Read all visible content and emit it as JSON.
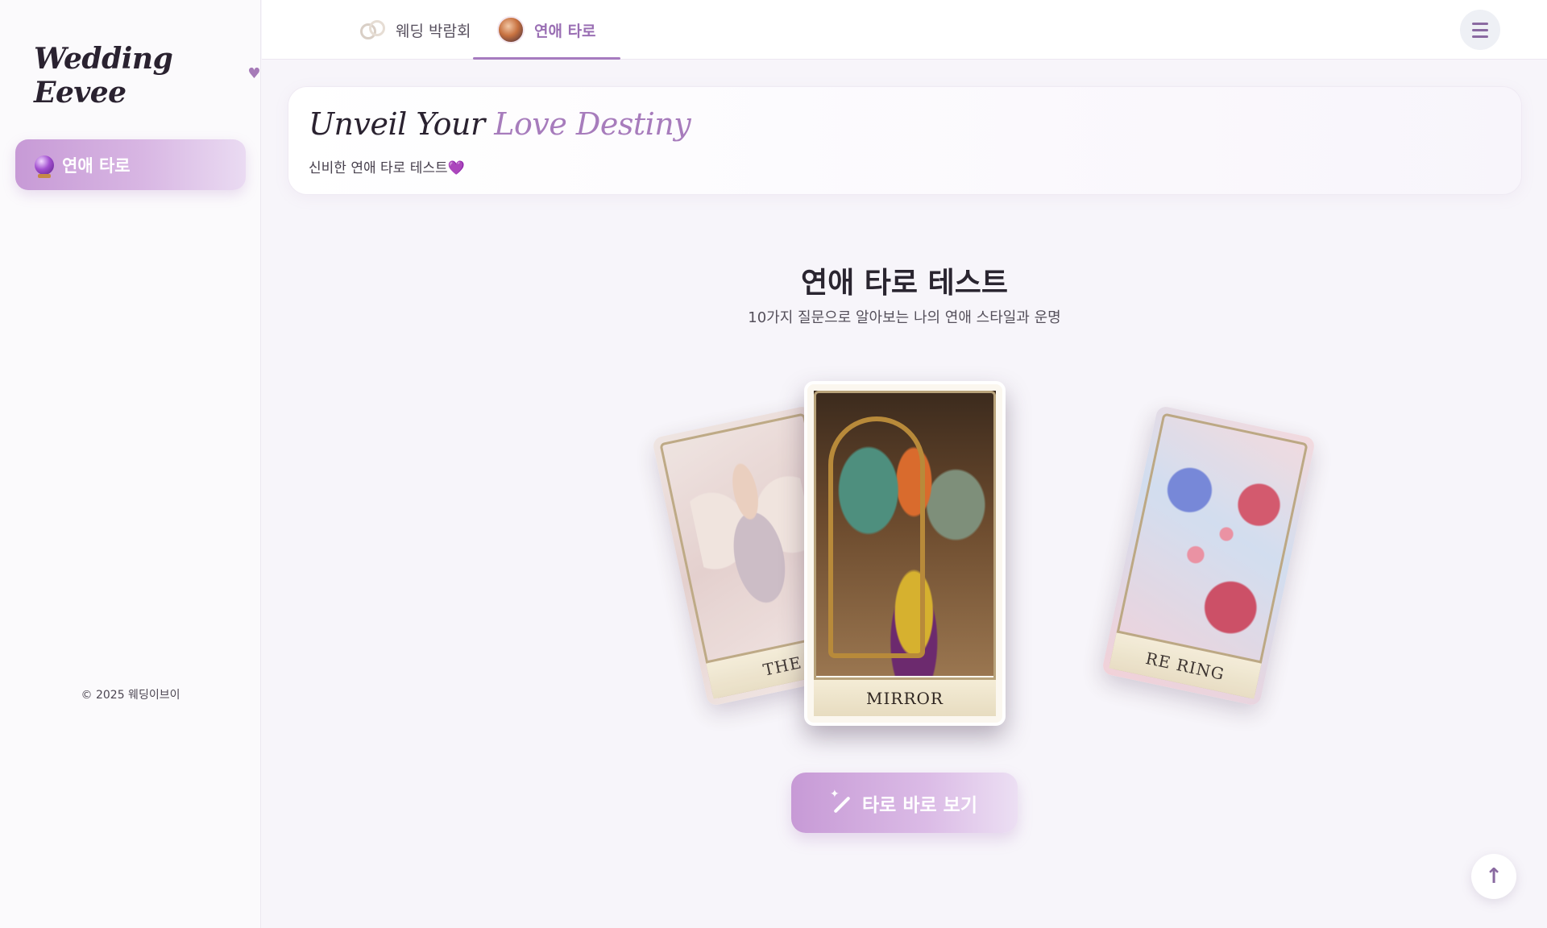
{
  "sidebar": {
    "brand": "Wedding Eevee",
    "brand_heart": "♥",
    "items": [
      {
        "label": "연애 타로",
        "icon": "crystal-ball-icon",
        "active": true
      }
    ],
    "copyright": "© 2025 웨딩이브이"
  },
  "topnav": {
    "tabs": [
      {
        "label": "웨딩 박람회",
        "icon": "wedding-rings-icon",
        "active": false
      },
      {
        "label": "연애 타로",
        "icon": "tarot-thumbnail-icon",
        "active": true
      }
    ],
    "menu_icon": "hamburger-menu-icon"
  },
  "hero": {
    "title_plain": "Unveil Your",
    "title_accent": "Love Destiny",
    "subtitle": "신비한 연애 타로 테스트",
    "subtitle_emoji": "💜"
  },
  "main": {
    "title": "연애 타로 테스트",
    "subtitle": "10가지 질문으로 알아보는 나의 연애 스타일과 운명",
    "cards": [
      {
        "position": "left",
        "label": "THE"
      },
      {
        "position": "center",
        "label": "MIRROR"
      },
      {
        "position": "right",
        "label": "RE RING"
      }
    ],
    "cta_label": "타로 바로 보기",
    "cta_icon": "magic-wand-icon"
  },
  "scroll_top_icon": "arrow-up-icon",
  "colors": {
    "accent": "#a77cbc",
    "button_gradient_start": "#c79ad6",
    "background": "#f7f5fa"
  }
}
